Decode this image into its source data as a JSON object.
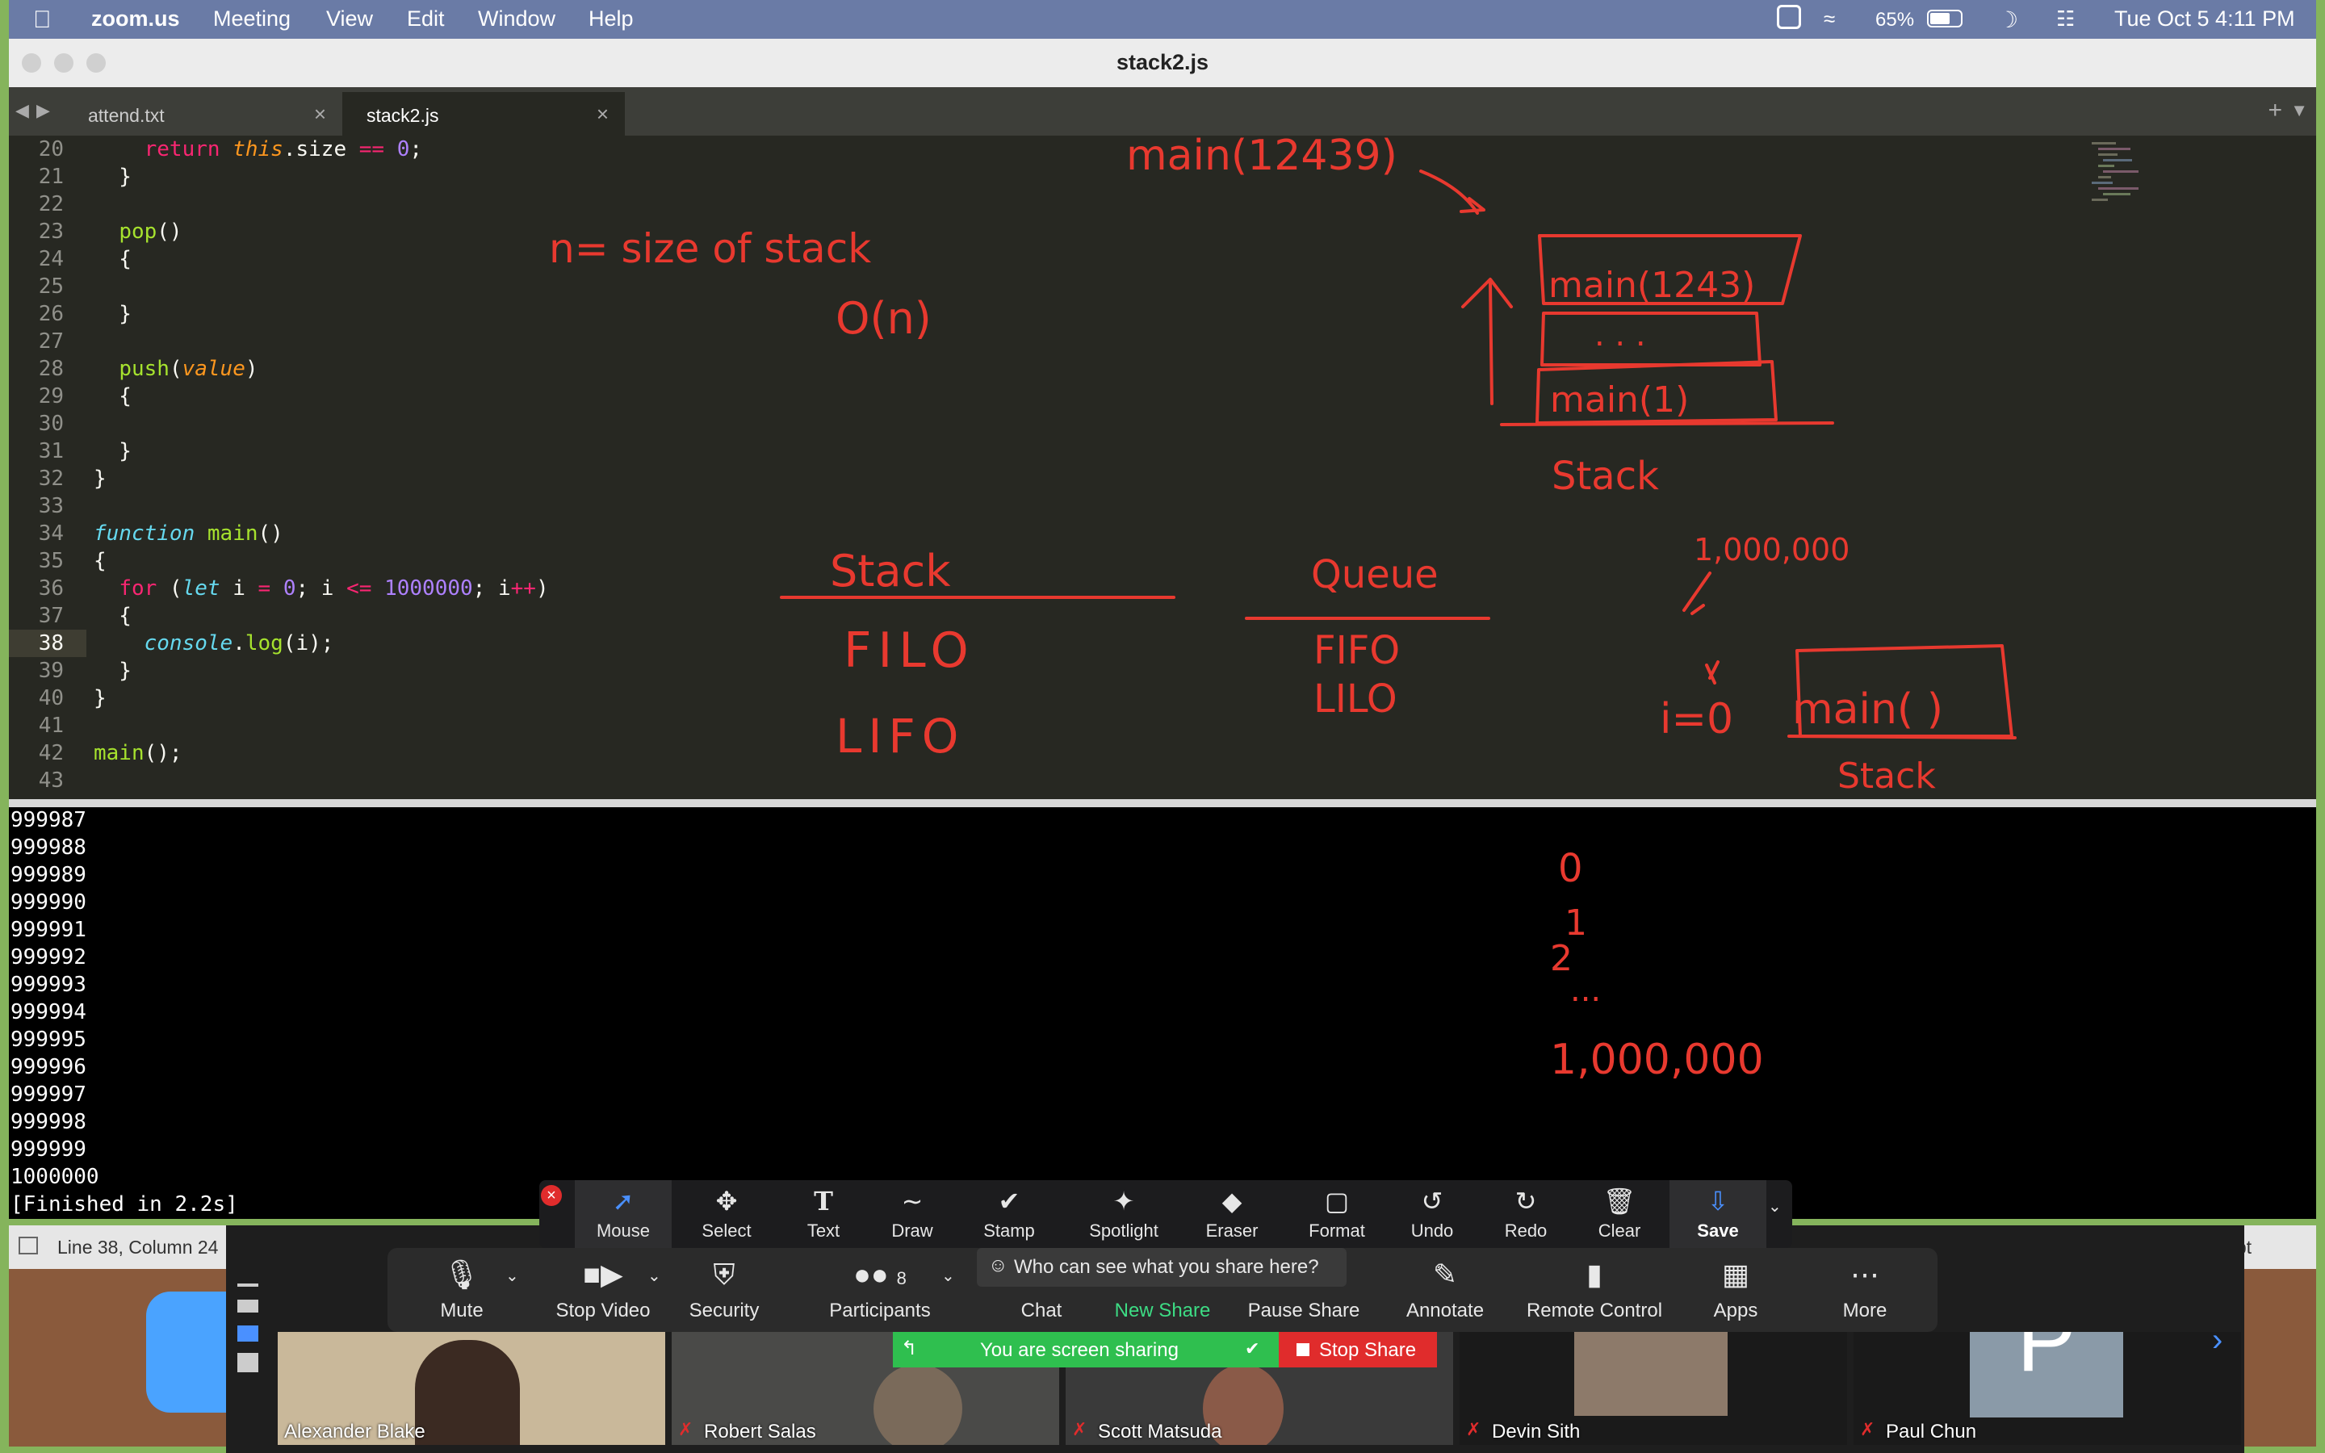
{
  "menubar": {
    "app": "zoom.us",
    "items": [
      "Meeting",
      "View",
      "Edit",
      "Window",
      "Help"
    ],
    "battery": "65%",
    "datetime": "Tue Oct 5  4:11 PM"
  },
  "window": {
    "title": "stack2.js"
  },
  "tabs": [
    {
      "label": "attend.txt"
    },
    {
      "label": "stack2.js"
    }
  ],
  "editor": {
    "line_numbers": [
      "20",
      "21",
      "22",
      "23",
      "24",
      "25",
      "26",
      "27",
      "28",
      "29",
      "30",
      "31",
      "32",
      "33",
      "34",
      "35",
      "36",
      "37",
      "38",
      "39",
      "40",
      "41",
      "42",
      "43"
    ],
    "current_line": "38"
  },
  "annotations": {
    "main_call": "main(12439)",
    "n_def": "n= size of stack",
    "big_o": "O(n)",
    "frame_top": "main(1243)",
    "frame_mid": ". . .",
    "frame_bottom": "main(1)",
    "stack_label_1": "Stack",
    "stack_header": "Stack",
    "filo": "FILO",
    "lifo": "LIFO",
    "queue_header": "Queue",
    "fifo": "FIFO",
    "lilo": "LILO",
    "million_1": "1,000,000",
    "i_zero": "i=0",
    "main_frame": "main( )",
    "stack_label_2": "Stack",
    "count_0": "0",
    "count_1": "1",
    "count_2": "2",
    "count_dots": "...",
    "million_2": "1,000,000"
  },
  "console": {
    "lines": [
      "999987",
      "999988",
      "999989",
      "999990",
      "999991",
      "999992",
      "999993",
      "999994",
      "999995",
      "999996",
      "999997",
      "999998",
      "999999",
      "1000000",
      "[Finished in 2.2s]"
    ]
  },
  "statusbar": {
    "position": "Line 38, Column 24",
    "syntax_fragment": "cript"
  },
  "annotate_toolbar": {
    "tools": [
      {
        "label": "Mouse",
        "icon": "cursor-arrow-icon"
      },
      {
        "label": "Select",
        "icon": "move-arrows-icon"
      },
      {
        "label": "Text",
        "icon": "text-t-icon"
      },
      {
        "label": "Draw",
        "icon": "squiggle-icon"
      },
      {
        "label": "Stamp",
        "icon": "checkmark-icon"
      },
      {
        "label": "Spotlight",
        "icon": "magic-wand-icon"
      },
      {
        "label": "Eraser",
        "icon": "eraser-icon"
      },
      {
        "label": "Format",
        "icon": "square-icon"
      },
      {
        "label": "Undo",
        "icon": "undo-icon"
      },
      {
        "label": "Redo",
        "icon": "redo-icon"
      },
      {
        "label": "Clear",
        "icon": "trash-icon"
      },
      {
        "label": "Save",
        "icon": "save-download-icon"
      }
    ]
  },
  "zoom_controls": {
    "buttons": [
      {
        "label": "Mute",
        "icon": "microphone-icon"
      },
      {
        "label": "Stop Video",
        "icon": "video-camera-icon"
      },
      {
        "label": "Security",
        "icon": "shield-icon"
      },
      {
        "label": "Participants",
        "icon": "participants-icon",
        "count": "8"
      },
      {
        "label": "Chat",
        "icon": "chat-icon"
      },
      {
        "label": "New Share",
        "icon": "share-screen-icon"
      },
      {
        "label": "Pause Share",
        "icon": "pause-icon"
      },
      {
        "label": "Annotate",
        "icon": "pencil-icon"
      },
      {
        "label": "Remote Control",
        "icon": "mouse-icon"
      },
      {
        "label": "Apps",
        "icon": "apps-icon"
      },
      {
        "label": "More",
        "icon": "ellipsis-icon"
      }
    ],
    "who_can_see": "Who can see what you share here?",
    "sharing_notice": "You are screen sharing",
    "stop_share": "Stop Share"
  },
  "participants": [
    {
      "name": "Alexander Blake"
    },
    {
      "name": "Robert Salas"
    },
    {
      "name": "Scott Matsuda"
    },
    {
      "name": "Devin Sith"
    },
    {
      "name": "Paul Chun",
      "initial": "P"
    }
  ],
  "colors": {
    "ink": "#e8392f",
    "editor_bg": "#272822",
    "new_share": "#3ddc84",
    "stop_share": "#e02c2c"
  }
}
